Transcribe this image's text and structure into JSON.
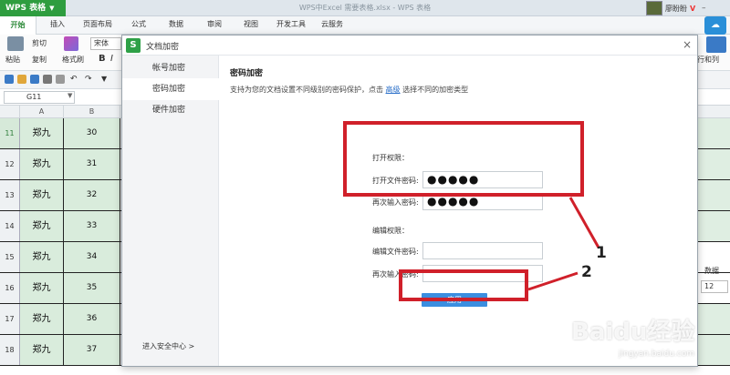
{
  "titlebar": {
    "app_name": "WPS 表格",
    "doc_title": "WPS中Excel 需要表格.xlsx - WPS 表格",
    "user_name": "廖盼盼",
    "user_badge": "V"
  },
  "ribbon": {
    "tabs": [
      "开始",
      "插入",
      "页面布局",
      "公式",
      "数据",
      "审阅",
      "视图",
      "开发工具",
      "云服务"
    ]
  },
  "toolbar": {
    "cut": "剪切",
    "paste": "粘贴",
    "copy": "复制",
    "format_painter": "格式刷",
    "font": "宋体",
    "bold": "B",
    "italic": "I",
    "rows_cols": "行和列"
  },
  "formula_bar": {
    "cell_ref": "G11"
  },
  "sheet": {
    "columns": [
      "A",
      "B"
    ],
    "rows": [
      {
        "num": "11",
        "a": "郑九",
        "b": "30"
      },
      {
        "num": "12",
        "a": "郑九",
        "b": "31"
      },
      {
        "num": "13",
        "a": "郑九",
        "b": "32"
      },
      {
        "num": "14",
        "a": "郑九",
        "b": "33"
      },
      {
        "num": "15",
        "a": "郑九",
        "b": "34"
      },
      {
        "num": "16",
        "a": "郑九",
        "b": "35"
      },
      {
        "num": "17",
        "a": "郑九",
        "b": "36"
      },
      {
        "num": "18",
        "a": "郑九",
        "b": "37"
      }
    ],
    "right_label": "数据",
    "font_size": "12"
  },
  "dialog": {
    "title": "文档加密",
    "logo": "S",
    "close": "×",
    "side_items": [
      "帐号加密",
      "密码加密",
      "硬件加密"
    ],
    "side_footer": "进入安全中心 >",
    "section_title": "密码加密",
    "description_pre": "支持为您的文档设置不同级别的密码保护，点击",
    "description_link": "高级",
    "description_post": "选择不同的加密类型",
    "open_group": "打开权限：",
    "open_pwd_label": "打开文件密码:",
    "open_pwd_value": "●●●●●",
    "open_confirm_label": "再次输入密码:",
    "open_confirm_value": "●●●●●",
    "edit_group": "编辑权限：",
    "edit_pwd_label": "编辑文件密码:",
    "edit_pwd_value": "",
    "edit_confirm_label": "再次输入密码:",
    "edit_confirm_value": "",
    "apply": "应用"
  },
  "annotations": {
    "num1": "1",
    "num2": "2",
    "color": "#d0202a"
  },
  "watermark": {
    "main": "Baidu经验",
    "sub": "jingyan.baidu.com"
  }
}
